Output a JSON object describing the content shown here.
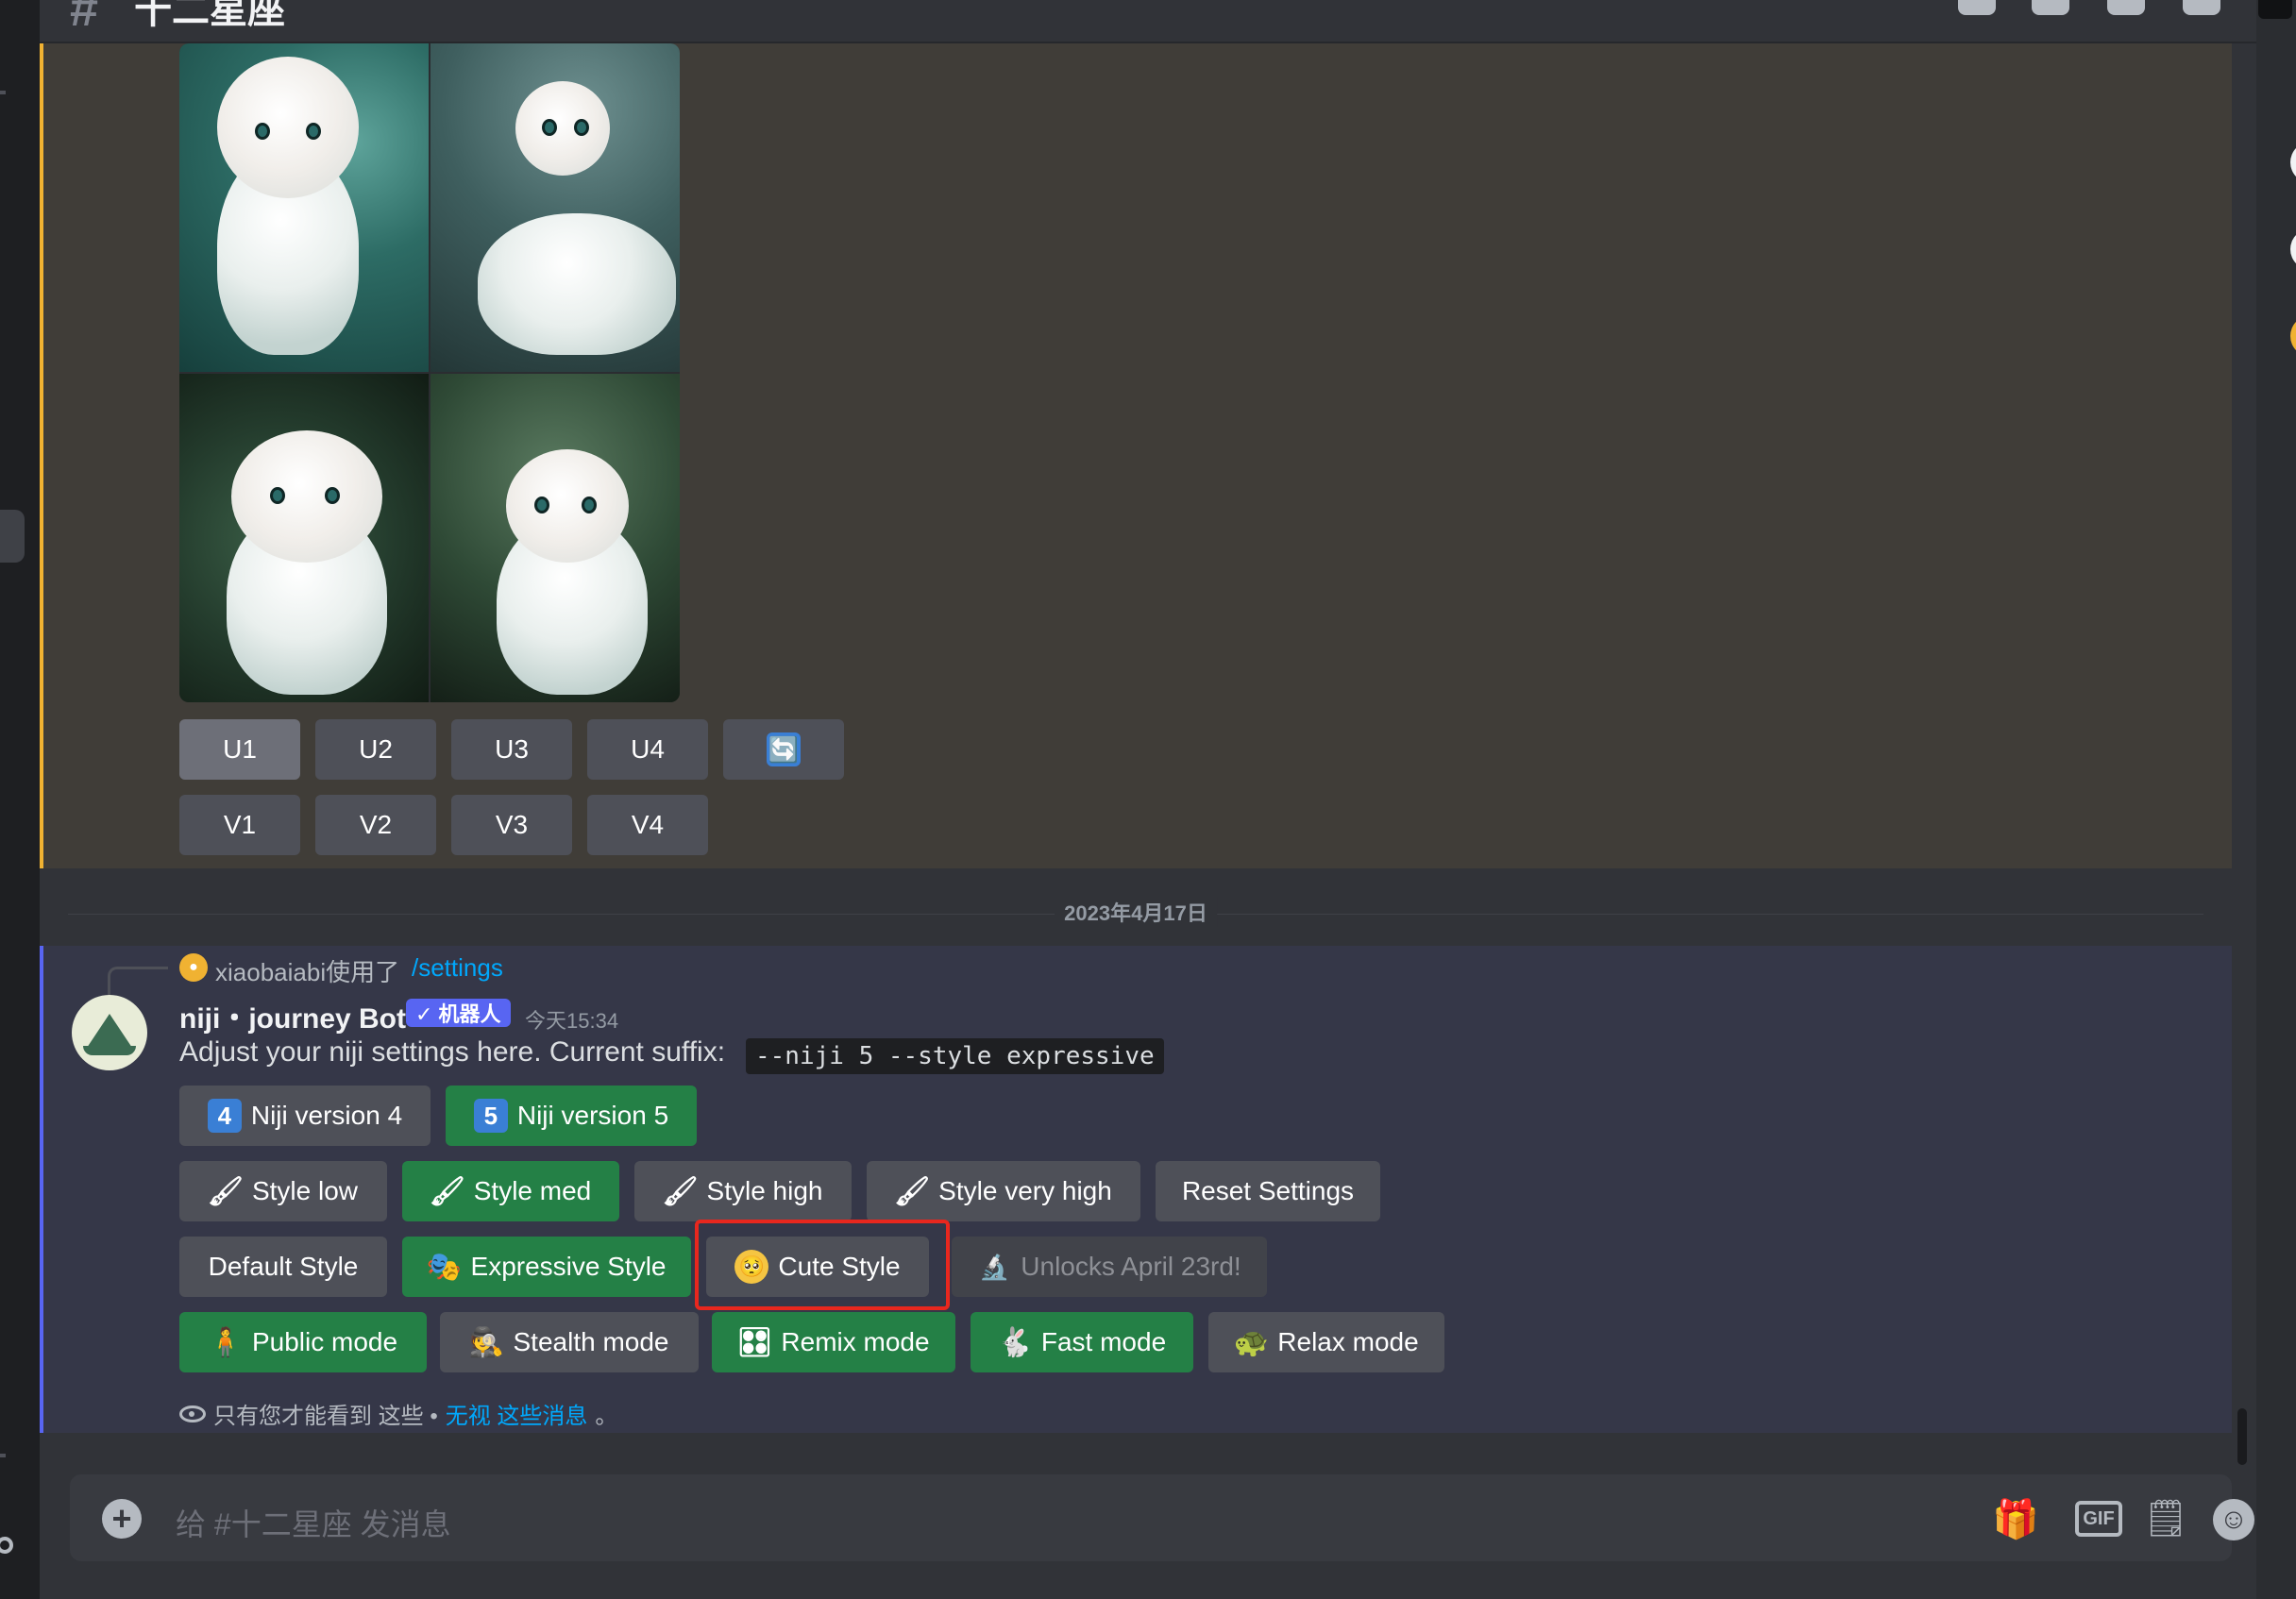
{
  "header": {
    "channel_title": "十二星座"
  },
  "previous_message": {
    "upscale_buttons": [
      "U1",
      "U2",
      "U3",
      "U4"
    ],
    "variation_buttons": [
      "V1",
      "V2",
      "V3",
      "V4"
    ],
    "reroll_icon": "🔄"
  },
  "date_divider": "2023年4月17日",
  "bot_message": {
    "reply": {
      "user_text": "xiaobaiabi使用了",
      "command": "/settings"
    },
    "bot_name": "niji・journey Bot",
    "badge": "✓ 机器人",
    "timestamp": "今天15:34",
    "text": "Adjust your niji settings here. Current suffix:",
    "suffix_code": "--niji 5 --style expressive",
    "version_row": [
      {
        "emoji": "4",
        "label": "Niji version 4"
      },
      {
        "emoji": "5",
        "label": "Niji version 5"
      }
    ],
    "style_row": [
      {
        "emoji": "🖌",
        "label": "Style low"
      },
      {
        "emoji": "🖌",
        "label": "Style med"
      },
      {
        "emoji": "🖌",
        "label": "Style high"
      },
      {
        "emoji": "🖌",
        "label": "Style very high"
      },
      {
        "label": "Reset Settings"
      }
    ],
    "preset_row": [
      {
        "label": "Default Style"
      },
      {
        "emoji": "🎭",
        "label": "Expressive Style"
      },
      {
        "emoji": "🥺",
        "label": "Cute Style"
      },
      {
        "emoji": "🔬",
        "label": "Unlocks April 23rd!"
      }
    ],
    "mode_row": [
      {
        "emoji": "🧍",
        "label": "Public mode"
      },
      {
        "emoji": "🕵",
        "label": "Stealth mode"
      },
      {
        "emoji": "🎛",
        "label": "Remix mode"
      },
      {
        "emoji": "🐇",
        "label": "Fast mode"
      },
      {
        "emoji": "🐢",
        "label": "Relax mode"
      }
    ],
    "ephemeral_note": {
      "prefix": "只有您才能看到 这些 • ",
      "dismiss": "无视 这些消息",
      "suffix": "。"
    }
  },
  "composer": {
    "placeholder": "给 #十二星座 发消息",
    "plus_icon": "+",
    "gift_icon": "🎁",
    "gif_label": "GIF",
    "sticker_icon": "🗒",
    "emoji_icon": "☺"
  },
  "icons": {
    "header": [
      "threads-icon",
      "bell-icon",
      "pin-icon",
      "members-icon"
    ],
    "left": [
      "gear-icon"
    ]
  },
  "colors": {
    "accent": "#5865f2",
    "green": "#248046",
    "mention_bar": "#f0b232",
    "highlight_box": "#e8271e",
    "link": "#00a8fc"
  }
}
